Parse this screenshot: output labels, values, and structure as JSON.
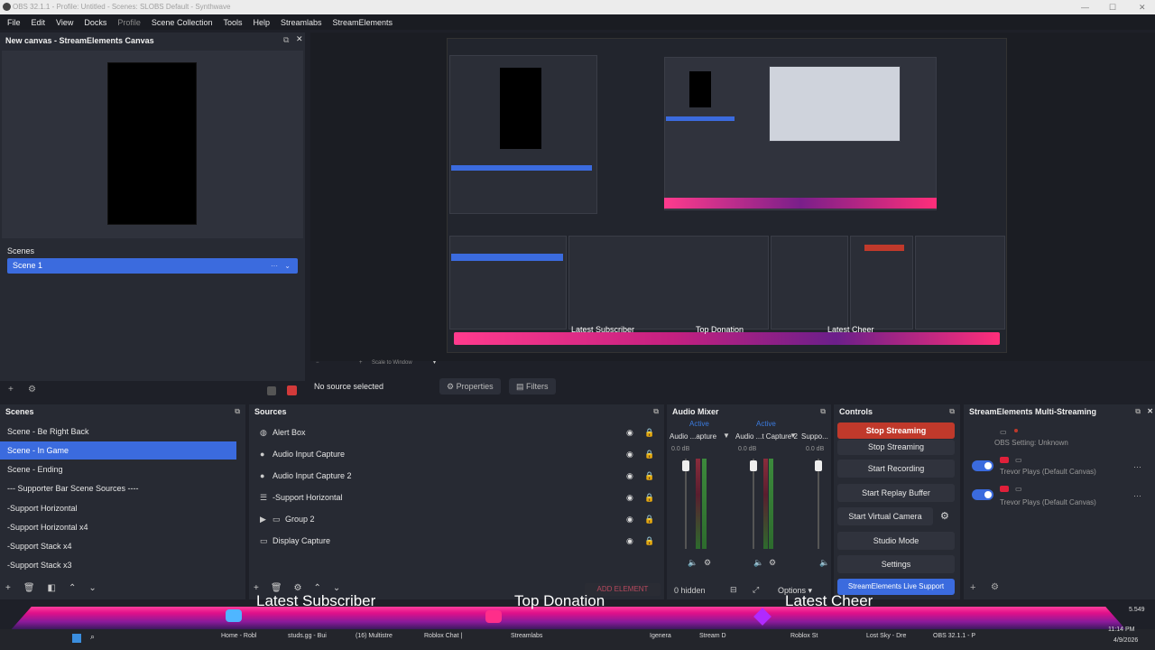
{
  "window": {
    "title": "OBS 32.1.1 - Profile: Untitled - Scenes: SLOBS Default - Synthwave"
  },
  "menu": [
    "File",
    "Edit",
    "View",
    "Docks",
    "Profile",
    "Scene Collection",
    "Tools",
    "Help",
    "Streamlabs",
    "StreamElements"
  ],
  "canvas_dock": {
    "title": "New canvas - StreamElements Canvas",
    "scenes_title": "Scenes",
    "scene_item": "Scene 1"
  },
  "preview": {
    "overlay_labels": [
      "Latest Subscriber",
      "Top Donation",
      "Latest Cheer"
    ],
    "zoom_text": "Scale to Window"
  },
  "source_toolbar": {
    "status": "No source selected",
    "properties": "Properties",
    "filters": "Filters"
  },
  "scenes_dock": {
    "title": "Scenes",
    "items": [
      "Scene - Be Right Back",
      "Scene - In Game",
      "Scene - Ending",
      "--- Supporter Bar Scene Sources ----",
      "-Support Horizontal",
      "-Support Horizontal x4",
      "-Support Stack x4",
      "-Support Stack x3"
    ],
    "selected_index": 1
  },
  "sources_dock": {
    "title": "Sources",
    "items": [
      {
        "label": "Alert Box",
        "icon": "globe-icon"
      },
      {
        "label": "Audio Input Capture",
        "icon": "mic-icon"
      },
      {
        "label": "Audio Input Capture 2",
        "icon": "mic-icon"
      },
      {
        "label": "-Support Horizontal",
        "icon": "list-icon"
      },
      {
        "label": "Group 2",
        "icon": "folder-icon"
      },
      {
        "label": "Display Capture",
        "icon": "monitor-icon"
      }
    ],
    "add_element": "ADD ELEMENT"
  },
  "audio_mixer": {
    "title": "Audio Mixer",
    "channels": [
      {
        "name": "Audio ...apture",
        "status": "Active",
        "db": "0.0 dB"
      },
      {
        "name": "Audio ...t Capture 2",
        "status": "Active",
        "db": "0.0 dB"
      },
      {
        "name": "Suppo...",
        "status": "",
        "db": "0.0 dB"
      }
    ],
    "hidden": "0 hidden",
    "options": "Options"
  },
  "controls": {
    "title": "Controls",
    "buttons": [
      "Stop Streaming",
      "Stop Streaming",
      "Start Recording",
      "Start Replay Buffer",
      "Start Virtual Camera",
      "Studio Mode",
      "Settings",
      "StreamElements Live Support"
    ]
  },
  "multistream": {
    "title": "StreamElements Multi-Streaming",
    "obs_setting": "OBS Setting: Unknown",
    "targets": [
      {
        "name": "Trevor Plays (Default Canvas)"
      },
      {
        "name": "Trevor Plays (Default Canvas)"
      }
    ]
  },
  "overlay": {
    "labels": [
      "Latest Subscriber",
      "Top Donation",
      "Latest Cheer"
    ]
  },
  "taskbar": {
    "items": [
      "Home - Robl",
      "studs.gg - Bui",
      "(16) Multistre",
      "Roblox Chat |",
      "Streamlabs",
      "Igenera",
      "Stream D",
      "Roblox St",
      "Lost Sky - Dre",
      "OBS 32.1.1 - P"
    ],
    "clock_time": "11:14 PM",
    "clock_date": "4/9/2026",
    "tray_number": "5.549"
  },
  "colors": {
    "accent": "#3b6bde",
    "stop_streaming": "#c0392b",
    "overlay_pink": "#ff2e8a"
  }
}
